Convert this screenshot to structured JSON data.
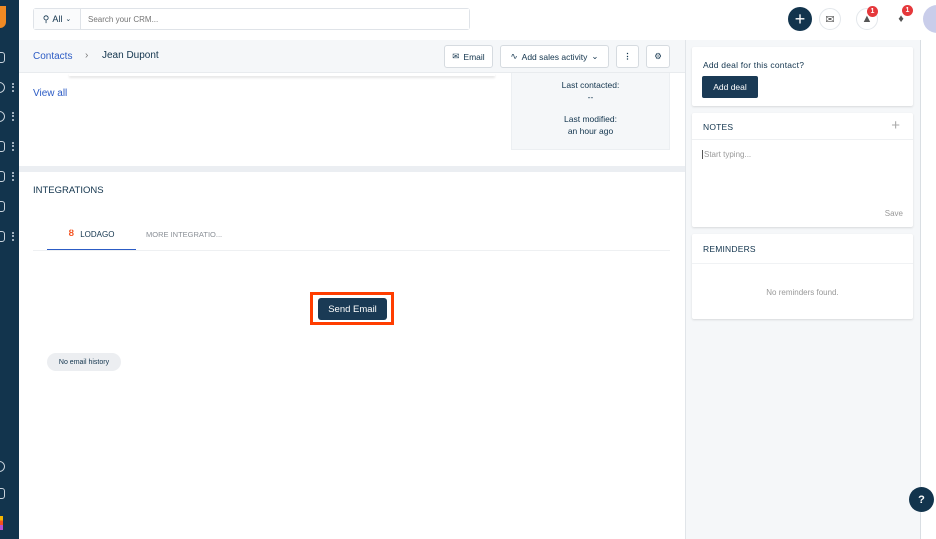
{
  "search": {
    "scope": "All",
    "placeholder": "Search your CRM..."
  },
  "header": {
    "notif_badge_1": "1",
    "notif_badge_2": "1"
  },
  "breadcrumb": {
    "parent": "Contacts",
    "current": "Jean Dupont"
  },
  "toolbar": {
    "email_label": "Email",
    "sales_activity_label": "Add sales activity"
  },
  "main": {
    "view_all": "View all",
    "last_contacted_label": "Last contacted:",
    "last_contacted_value": "--",
    "last_modified_label": "Last modified:",
    "last_modified_value": "an hour ago"
  },
  "integrations": {
    "title": "INTEGRATIONS",
    "tabs": [
      {
        "label": "LODAGO",
        "active": true
      },
      {
        "label": "MORE INTEGRATIO..."
      }
    ],
    "send_email": "Send Email",
    "no_history": "No email history"
  },
  "deal": {
    "question": "Add deal for this contact?",
    "button": "Add deal"
  },
  "notes": {
    "title": "NOTES",
    "placeholder": "Start typing...",
    "save": "Save"
  },
  "reminders": {
    "title": "REMINDERS",
    "empty": "No reminders found."
  },
  "help": {
    "label": "?"
  },
  "colors": {
    "navy": "#12344d",
    "link": "#2c5cc5",
    "highlight": "#ff3d00",
    "lodago": "#f4511e"
  }
}
